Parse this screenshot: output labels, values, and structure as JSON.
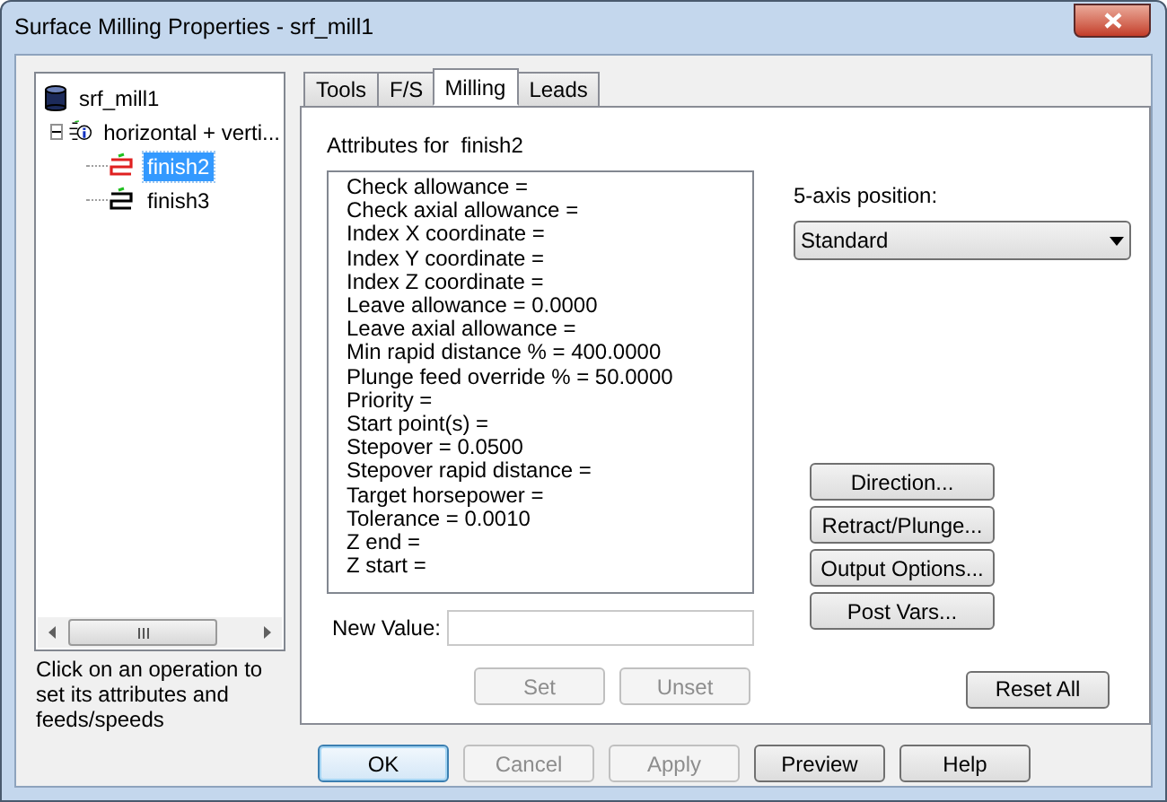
{
  "window": {
    "title": "Surface Milling Properties - srf_mill1"
  },
  "tree": [
    {
      "label": "srf_mill1",
      "kind": "setup",
      "selected": false,
      "children": [
        {
          "label": "horizontal + verti...",
          "kind": "group",
          "selected": false,
          "expanded": true,
          "children": [
            {
              "label": "finish2",
              "kind": "operation",
              "color": "#e02020",
              "selected": true
            },
            {
              "label": "finish3",
              "kind": "operation",
              "color": "#000000",
              "selected": false
            }
          ]
        }
      ]
    }
  ],
  "hint": "Click on an operation to set its attributes and feeds/speeds",
  "tabs": [
    {
      "label": "Tools",
      "selected": false
    },
    {
      "label": "F/S",
      "selected": false
    },
    {
      "label": "Milling",
      "selected": true
    },
    {
      "label": "Leads",
      "selected": false
    }
  ],
  "attributes_label": "Attributes for  finish2",
  "attributes": [
    "Check allowance =",
    "Check axial allowance =",
    "Index X coordinate =",
    "Index Y coordinate =",
    "Index Z coordinate =",
    "Leave allowance = 0.0000",
    "Leave axial allowance =",
    "Min rapid distance % = 400.0000",
    "Plunge feed override % = 50.0000",
    "Priority =",
    "Start point(s) =",
    "Stepover = 0.0500",
    "Stepover rapid distance =",
    "Target horsepower =",
    "Tolerance = 0.0010",
    "Z end =",
    "Z start ="
  ],
  "new_value": {
    "label": "New Value:"
  },
  "value_buttons": [
    {
      "label": "Set",
      "disabled": true
    },
    {
      "label": "Unset",
      "disabled": true
    }
  ],
  "five_axis": {
    "label": "5-axis position:",
    "value": "Standard"
  },
  "side_buttons": [
    "Direction...",
    "Retract/Plunge...",
    "Output Options...",
    "Post Vars..."
  ],
  "reset_button": "Reset All",
  "footer_buttons": [
    {
      "label": "OK",
      "disabled": false,
      "default": true
    },
    {
      "label": "Cancel",
      "disabled": true,
      "default": false
    },
    {
      "label": "Apply",
      "disabled": true,
      "default": false
    },
    {
      "label": "Preview",
      "disabled": false,
      "default": false
    },
    {
      "label": "Help",
      "disabled": false,
      "default": false
    }
  ]
}
